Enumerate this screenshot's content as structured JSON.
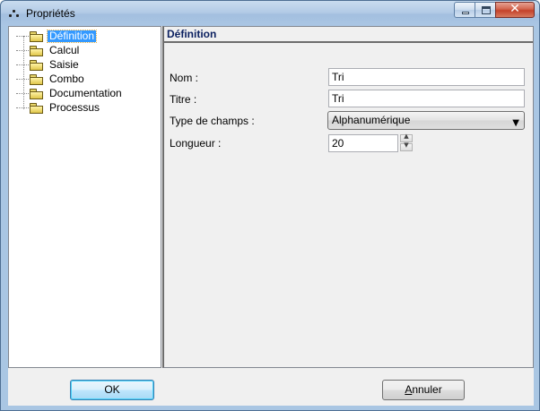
{
  "window": {
    "title": "Propriétés",
    "close_glyph": "✕"
  },
  "tree": {
    "items": [
      {
        "label": "Définition",
        "selected": true
      },
      {
        "label": "Calcul",
        "selected": false
      },
      {
        "label": "Saisie",
        "selected": false
      },
      {
        "label": "Combo",
        "selected": false
      },
      {
        "label": "Documentation",
        "selected": false
      },
      {
        "label": "Processus",
        "selected": false
      }
    ]
  },
  "panel": {
    "header": "Définition",
    "fields": {
      "nom": {
        "label": "Nom :",
        "value": "Tri"
      },
      "titre": {
        "label": "Titre :",
        "value": "Tri"
      },
      "type": {
        "label": "Type de champs :",
        "value": "Alphanumérique"
      },
      "longueur": {
        "label": "Longueur :",
        "value": "20"
      }
    }
  },
  "buttons": {
    "ok": "OK",
    "cancel_first": "A",
    "cancel_rest": "nnuler"
  },
  "colors": {
    "selection": "#3399ff",
    "header_text": "#0a1f5f",
    "ok_border": "#3c7fb1"
  },
  "icons": {
    "tree_item": "folder-icon",
    "dropdown": "chevron-down-icon",
    "spin_up": "spin-up-icon",
    "spin_down": "spin-down-icon"
  }
}
